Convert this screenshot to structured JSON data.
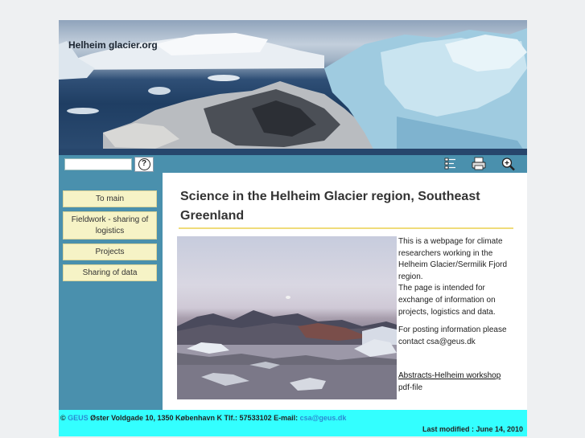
{
  "site": {
    "title": "Helheim glacier.org"
  },
  "toolbar": {
    "search_placeholder": "",
    "help_label": "?",
    "icons": [
      "sitemap-icon",
      "print-icon",
      "zoom-icon"
    ]
  },
  "sidebar": {
    "items": [
      {
        "label": "To main"
      },
      {
        "label": "Fieldwork - sharing of logistics"
      },
      {
        "label": "Projects"
      },
      {
        "label": "Sharing of data"
      }
    ]
  },
  "main": {
    "heading": "Science in the Helheim Glacier region, Southeast Greenland",
    "intro_1": "This is a webpage for climate researchers working in the Helheim Glacier/Sermilik Fjord region.",
    "intro_2": "The page is intended for exchange of information on projects, logistics and data.",
    "contact": "For posting information please contact csa@geus.dk",
    "abstracts_link": "Abstracts-Helheim workshop",
    "pdf_note": "pdf-file"
  },
  "footer": {
    "copyright": "©",
    "org": "GEUS",
    "address": " Øster Voldgade 10, 1350 København K Tlf.: 57533102 E-mail: ",
    "email": "csa@geus.dk",
    "last_modified": "Last modified : June 14, 2010"
  },
  "colors": {
    "sidebar_bg": "#4a90ad",
    "nav_button_bg": "#f6f3c6",
    "footer_bg": "#33ffff",
    "heading_rule": "#f0dc7a",
    "footer_accent": "#2b8ad2"
  }
}
